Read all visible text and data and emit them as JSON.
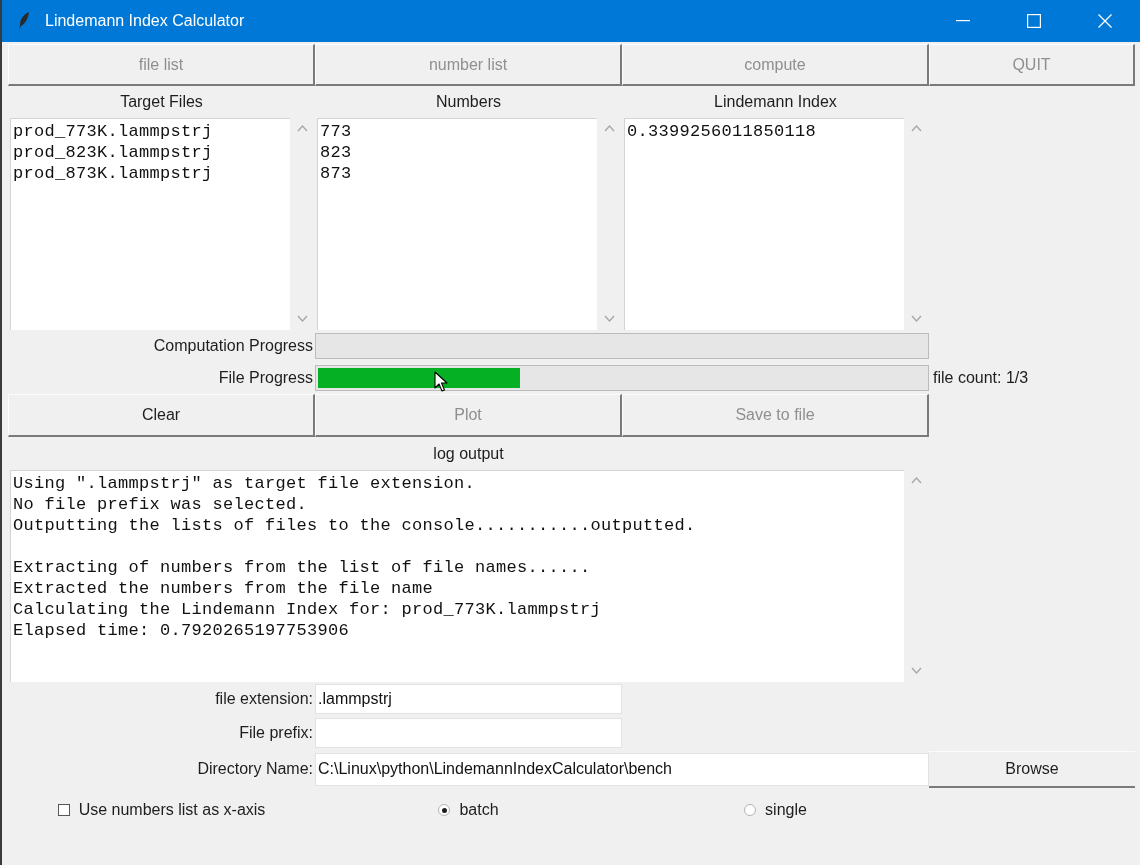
{
  "window": {
    "title": "Lindemann Index Calculator"
  },
  "toolbar": [
    {
      "label": "file list",
      "disabled": true
    },
    {
      "label": "number list",
      "disabled": true
    },
    {
      "label": "compute",
      "disabled": true
    },
    {
      "label": "QUIT",
      "disabled": true
    }
  ],
  "panels": [
    {
      "heading": "Target Files",
      "lines": [
        "prod_773K.lammpstrj",
        "prod_823K.lammpstrj",
        "prod_873K.lammpstrj"
      ]
    },
    {
      "heading": "Numbers",
      "lines": [
        "773",
        "823",
        "873"
      ]
    },
    {
      "heading": "Lindemann Index",
      "lines": [
        "0.3399256011850118"
      ]
    }
  ],
  "progress": [
    {
      "label": "Computation Progress",
      "level": 0
    },
    {
      "label": "File Progress",
      "level": 0.333,
      "reading": "file count: 1/3"
    }
  ],
  "actions": [
    {
      "label": "Clear",
      "disabled": false
    },
    {
      "label": "Plot",
      "disabled": true
    },
    {
      "label": "Save to file",
      "disabled": true
    }
  ],
  "log": {
    "heading": "log output",
    "text": "Using \".lammpstrj\" as target file extension.\nNo file prefix was selected.\nOutputting the lists of files to the console...........outputted.\n\nExtracting of numbers from the list of file names......\nExtracted the numbers from the file name\nCalculating the Lindemann Index for: prod_773K.lammpstrj\nElapsed time: 0.7920265197753906"
  },
  "fields": [
    {
      "label": "file extension:",
      "value": ".lammpstrj",
      "wide": false
    },
    {
      "label": "File prefix:",
      "wide": false
    },
    {
      "label": "Directory Name:",
      "value": "C:\\Linux\\python\\LindemannIndexCalculator\\bench",
      "wide": true,
      "button": "Browse"
    }
  ],
  "options": {
    "checkbox": {
      "label": "Use numbers list as x-axis",
      "checked": false
    },
    "modes": [
      {
        "label": "batch",
        "selected": true
      },
      {
        "label": "single",
        "selected": false
      }
    ]
  }
}
